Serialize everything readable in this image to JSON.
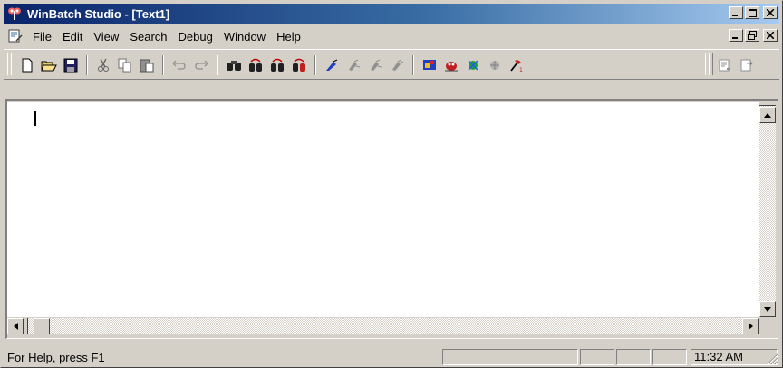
{
  "window": {
    "title": "WinBatch Studio - [Text1]",
    "app_icon": "winbatch-logo-icon",
    "caption_buttons": [
      "minimize",
      "restore",
      "close"
    ],
    "mdi_buttons": [
      "minimize",
      "restore",
      "close"
    ],
    "title_gradient": [
      "#0a246a",
      "#a6caf0"
    ]
  },
  "menu": {
    "doc_icon": "document-icon",
    "items": [
      {
        "label": "File"
      },
      {
        "label": "Edit"
      },
      {
        "label": "View"
      },
      {
        "label": "Search"
      },
      {
        "label": "Debug"
      },
      {
        "label": "Window"
      },
      {
        "label": "Help"
      }
    ]
  },
  "toolbar": {
    "buttons": [
      "new-file",
      "open-folder",
      "save",
      "cut",
      "copy",
      "paste",
      "undo",
      "redo",
      "find",
      "find-next",
      "find-previous",
      "replace",
      "bookmark",
      "step",
      "step-over",
      "run",
      "dialog-editor",
      "debug-bug",
      "goto-line",
      "toggle",
      "build",
      "compile",
      "export"
    ]
  },
  "editor": {
    "content": ""
  },
  "status": {
    "help_text": "For Help, press F1",
    "time": "11:32 AM"
  }
}
